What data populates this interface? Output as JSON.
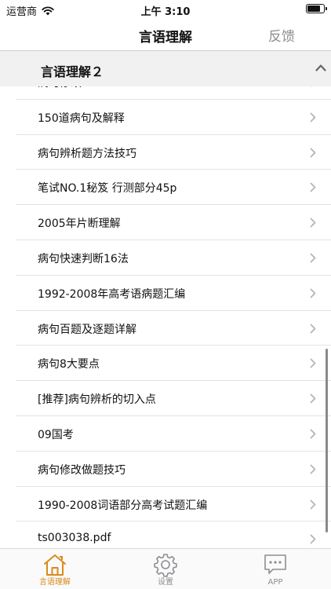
{
  "status_bar": {
    "carrier": "运营商",
    "time": "上午 3:10",
    "battery_level": 0.85
  },
  "nav": {
    "title": "言语理解",
    "feedback_label": "反馈"
  },
  "section": {
    "title": "言语理解２"
  },
  "list": {
    "items": [
      {
        "label": "病句修改"
      },
      {
        "label": "150道病句及解释"
      },
      {
        "label": "病句辨析题方法技巧"
      },
      {
        "label": "笔试NO.1秘笈 行测部分45p"
      },
      {
        "label": "2005年片断理解"
      },
      {
        "label": "病句快速判断16法"
      },
      {
        "label": "1992-2008年高考语病题汇编"
      },
      {
        "label": "病句百题及逐题详解"
      },
      {
        "label": "病句8大要点"
      },
      {
        "label": "[推荐]病句辨析的切入点"
      },
      {
        "label": "09国考"
      },
      {
        "label": "病句修改做题技巧"
      },
      {
        "label": "1990-2008词语部分高考试题汇编"
      },
      {
        "label": "ts003038.pdf"
      }
    ]
  },
  "tabs": [
    {
      "label": "言语理解",
      "icon": "home-icon",
      "active": true
    },
    {
      "label": "设置",
      "icon": "gear-icon",
      "active": false
    },
    {
      "label": "APP",
      "icon": "chat-icon",
      "active": false
    }
  ],
  "colors": {
    "accent": "#d98a1a",
    "inactive": "#8e8e93",
    "section_bg": "#f1f1f1"
  }
}
